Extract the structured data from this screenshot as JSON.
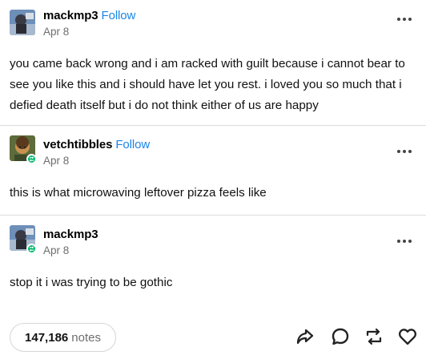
{
  "posts": [
    {
      "username": "mackmp3",
      "follow_label": "Follow",
      "date": "Apr 8",
      "reblogged": false,
      "text": "you came back wrong and i am racked with guilt because i cannot bear to see you like this and i should have let you rest. i loved you so much that i defied death itself but i do not think either of us are happy"
    },
    {
      "username": "vetchtibbles",
      "follow_label": "Follow",
      "date": "Apr 8",
      "reblogged": true,
      "text": "this is what microwaving leftover pizza feels like"
    },
    {
      "username": "mackmp3",
      "follow_label": "",
      "date": "Apr 8",
      "reblogged": true,
      "text": "stop it i was trying to be gothic"
    }
  ],
  "footer": {
    "notes_count": "147,186",
    "notes_label": "notes"
  },
  "icons": {
    "more": "more-options-icon",
    "share": "share-icon",
    "reply": "reply-icon",
    "reblog": "reblog-icon",
    "like": "heart-icon",
    "badge": "reblog-badge-icon"
  },
  "colors": {
    "follow": "#1a85e8",
    "badge": "#00b86b",
    "muted": "#6e6e6e",
    "divider": "#dcdcdc"
  }
}
